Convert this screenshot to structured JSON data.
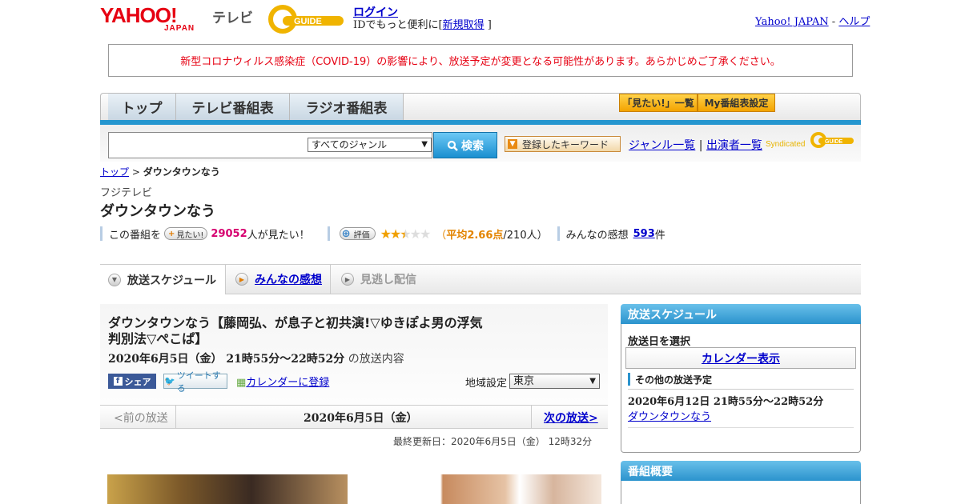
{
  "header": {
    "logo_yahoo": "YAHOO!",
    "logo_japan": "JAPAN",
    "logo_tv": "テレビ",
    "logo_gguide": "GUIDE",
    "login": "ログイン",
    "id_note_prefix": "IDでもっと便利に[",
    "signup": "新規取得",
    "id_note_suffix": "]",
    "yahoo_japan": "Yahoo! JAPAN",
    "sep": "-",
    "help": "ヘルプ"
  },
  "notice": "新型コロナウィルス感染症（COVID-19）の影響により、放送予定が変更となる可能性があります。あらかじめご了承ください。",
  "nav": {
    "tabs": [
      "トップ",
      "テレビ番組表",
      "ラジオ番組表"
    ],
    "mitai_list": "「見たい!」一覧",
    "my_schedule": "My番組表設定"
  },
  "search": {
    "genre_selected": "すべてのジャンル",
    "button": "検索",
    "keyword_button": "登録したキーワード",
    "genre_list": "ジャンル一覧",
    "pipe": "|",
    "performer_list": "出演者一覧",
    "syndicated": "Syndicated"
  },
  "breadcrumb": {
    "home": "トップ",
    "sep": ">",
    "current": "ダウンタウンなう"
  },
  "program": {
    "channel": "フジテレビ",
    "title": "ダウンタウンなう",
    "watch_prefix": "この番組を",
    "mitai_badge": "見たい!",
    "watch_count": "29052",
    "watch_suffix": "人が見たい！",
    "rate_badge": "評価",
    "rating": 2.66,
    "rating_open": "（",
    "rating_avg": "平均2.66点",
    "rating_count": "/210人）",
    "reviews_prefix": "みんなの感想",
    "reviews_count": "593",
    "reviews_suffix": "件"
  },
  "detail_tabs": [
    "放送スケジュール",
    "みんなの感想",
    "見逃し配信"
  ],
  "episode": {
    "title": "ダウンタウンなう【藤岡弘、が息子と初共演!▽ゆきぽよ男の浮気判別法▽ぺこぱ】",
    "datetime": "2020年6月5日（金） 21時55分～22時52分",
    "datetime_suffix": "の放送内容",
    "share_fb": "シェア",
    "share_tw": "ツイートする",
    "calendar_register": "カレンダーに登録",
    "region_label": "地域設定",
    "region": "東京",
    "prev": "<前の放送",
    "air_date": "2020年6月5日（金）",
    "next": "次の放送>",
    "updated": "最終更新日：2020年6月5日（金） 12時32分"
  },
  "sidebar": {
    "schedule_title": "放送スケジュール",
    "select_date": "放送日を選択",
    "calendar_view": "カレンダー表示",
    "other_title": "その他の放送予定",
    "other_date": "2020年6月12日 21時55分～22時52分",
    "other_link": "ダウンタウンなう",
    "summary_title": "番組概要"
  },
  "colors": {
    "accent_blue": "#2596cf",
    "brand_red": "#e60012",
    "rating_orange": "#e38400",
    "watch_pink": "#d6006f"
  }
}
